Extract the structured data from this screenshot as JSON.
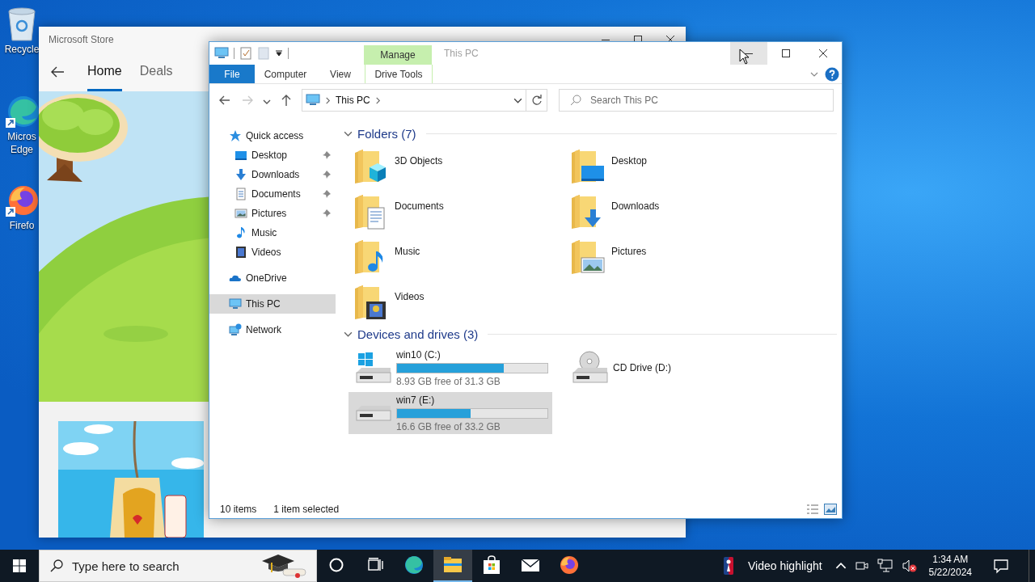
{
  "desktop_icons": [
    {
      "kind": "recyclebin",
      "label_lines": [
        "Recycle"
      ]
    },
    {
      "kind": "edge",
      "label_lines": [
        "Micros",
        "Edge"
      ]
    },
    {
      "kind": "firefox",
      "label_lines": [
        "Firefo"
      ]
    }
  ],
  "store": {
    "title": "Microsoft Store",
    "nav": [
      {
        "label": "Home",
        "selected": true
      },
      {
        "label": "Deals",
        "selected": false
      }
    ]
  },
  "explorer": {
    "context_tab": "Manage",
    "title": "This PC",
    "window_buttons": [
      {
        "kind": "minimize",
        "hovered": true
      },
      {
        "kind": "maximize",
        "hovered": false
      },
      {
        "kind": "close",
        "hovered": false
      }
    ],
    "ribbon_tabs": [
      {
        "label": "File",
        "kind": "file"
      },
      {
        "label": "Computer",
        "kind": "tab"
      },
      {
        "label": "View",
        "kind": "tab"
      },
      {
        "label": "Drive Tools",
        "kind": "context"
      }
    ],
    "nav_buttons": [
      {
        "kind": "back",
        "disabled": false
      },
      {
        "kind": "forward",
        "disabled": true
      },
      {
        "kind": "recent",
        "disabled": false
      },
      {
        "kind": "up",
        "disabled": false
      }
    ],
    "address": {
      "crumbs": [
        "This PC"
      ]
    },
    "search": {
      "placeholder": "Search This PC"
    },
    "nav_pane": [
      {
        "label": "Quick access",
        "kind": "quickaccess",
        "selected": false,
        "children": [
          {
            "label": "Desktop",
            "kind": "desktop",
            "pinned": true,
            "selected": false
          },
          {
            "label": "Downloads",
            "kind": "downloads",
            "pinned": true,
            "selected": false
          },
          {
            "label": "Documents",
            "kind": "documents",
            "pinned": true,
            "selected": false
          },
          {
            "label": "Pictures",
            "kind": "pictures",
            "pinned": true,
            "selected": false
          },
          {
            "label": "Music",
            "kind": "music",
            "pinned": false,
            "selected": false
          },
          {
            "label": "Videos",
            "kind": "videos",
            "pinned": false,
            "selected": false
          }
        ]
      },
      {
        "label": "OneDrive",
        "kind": "onedrive",
        "selected": false
      },
      {
        "label": "This PC",
        "kind": "pc",
        "selected": true
      },
      {
        "label": "Network",
        "kind": "network",
        "selected": false
      }
    ],
    "groups": [
      {
        "title": "Folders (7)",
        "expanded": true,
        "items": [
          {
            "name": "3D Objects",
            "kind": "objects"
          },
          {
            "name": "Desktop",
            "kind": "desktop"
          },
          {
            "name": "Documents",
            "kind": "documents"
          },
          {
            "name": "Downloads",
            "kind": "downloads"
          },
          {
            "name": "Music",
            "kind": "music"
          },
          {
            "name": "Pictures",
            "kind": "pictures"
          },
          {
            "name": "Videos",
            "kind": "videos"
          }
        ]
      },
      {
        "title": "Devices and drives (3)",
        "expanded": true,
        "items": [
          {
            "name": "win10 (C:)",
            "kind": "systemdrive",
            "level": 0.71,
            "free": "8.93 GB free of 31.3 GB",
            "selected": false
          },
          {
            "name": "CD Drive (D:)",
            "kind": "opticaldrive",
            "selected": false
          },
          {
            "name": "win7 (E:)",
            "kind": "drive",
            "level": 0.49,
            "free": "16.6 GB free of 33.2 GB",
            "selected": true
          }
        ]
      }
    ],
    "status": {
      "count": "10 items",
      "selection": "1 item selected"
    }
  },
  "taskbar": {
    "search": {
      "placeholder": "Type here to search"
    },
    "apps": [
      {
        "kind": "cortana",
        "active": false
      },
      {
        "kind": "taskview",
        "active": false
      },
      {
        "kind": "edge",
        "active": false
      },
      {
        "kind": "explorer",
        "active": true
      },
      {
        "kind": "store",
        "active": false
      },
      {
        "kind": "mail",
        "active": false
      },
      {
        "kind": "firefox",
        "active": false
      }
    ],
    "news": "Video highlight",
    "volume_muted": true,
    "time": "1:34 AM",
    "date": "5/22/2024"
  }
}
